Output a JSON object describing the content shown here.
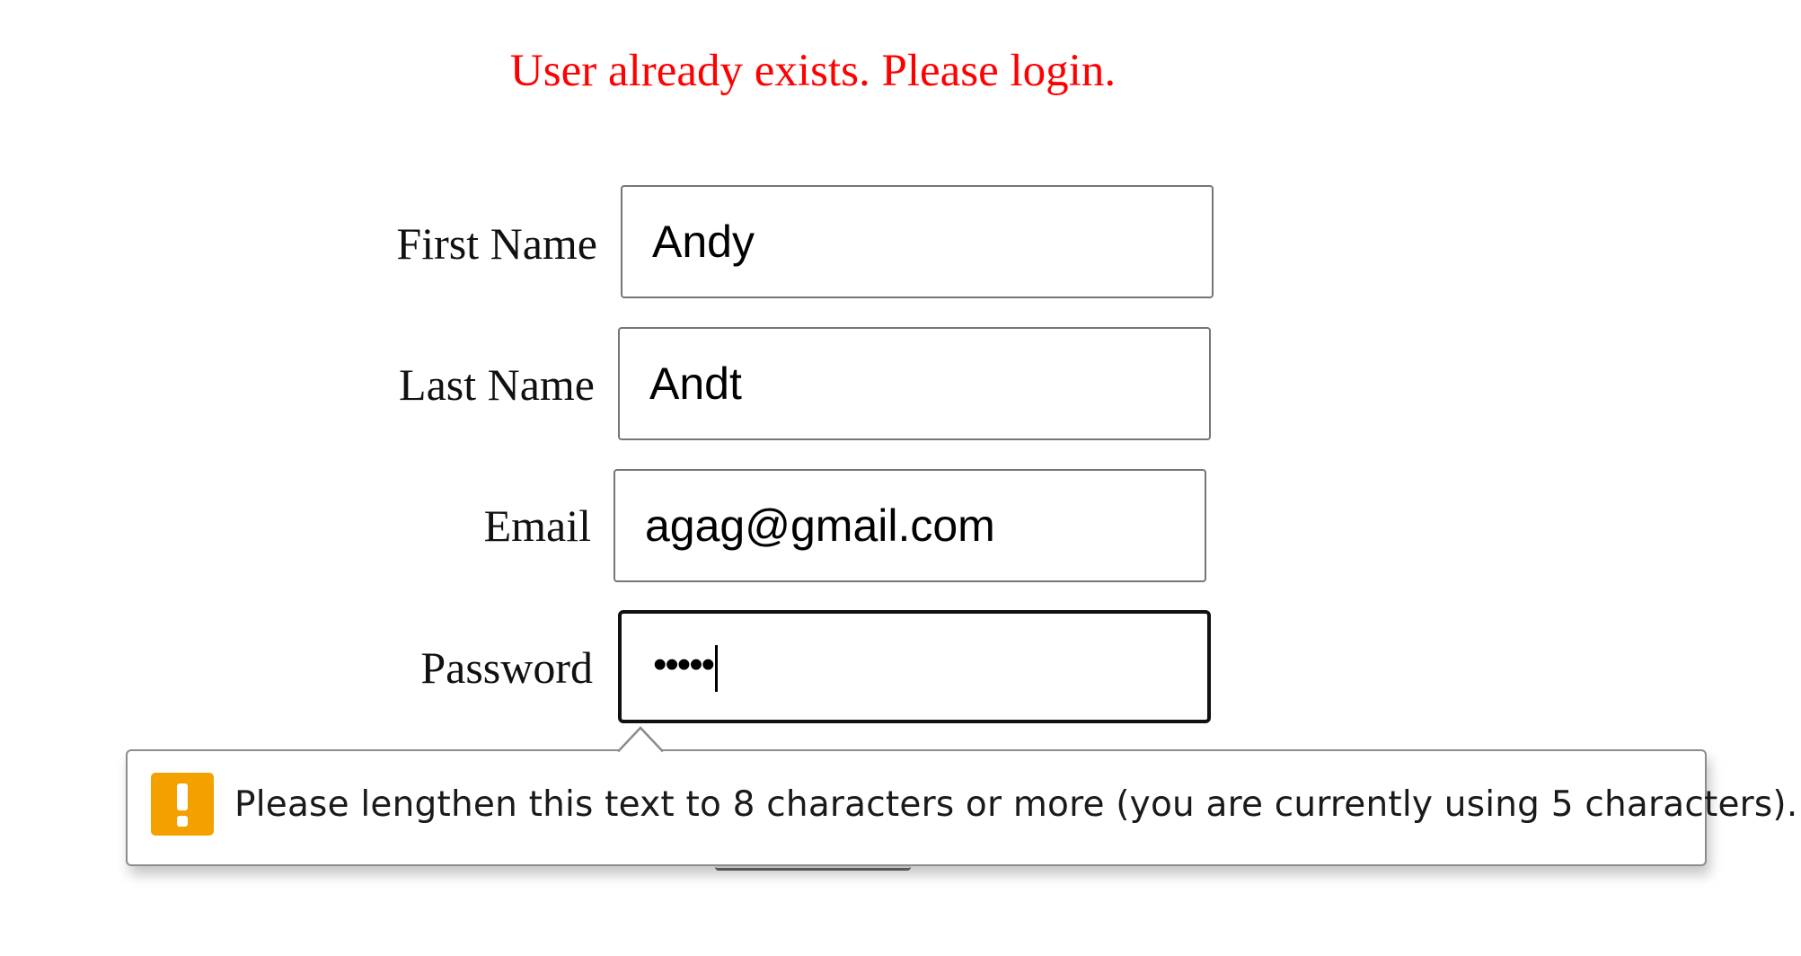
{
  "error_message": "User already exists. Please login.",
  "colors": {
    "error": "#ff0000",
    "warning_icon": "#f4a100"
  },
  "form": {
    "first_name": {
      "label": "First Name",
      "value": "Andy"
    },
    "last_name": {
      "label": "Last Name",
      "value": "Andt"
    },
    "email": {
      "label": "Email",
      "value": "agag@gmail.com"
    },
    "password": {
      "label": "Password",
      "masked_value": "•••••",
      "focused": true
    }
  },
  "validation_tooltip": {
    "icon": "warning-icon",
    "message": "Please lengthen this text to 8 characters or more (you are currently using 5 characters)."
  }
}
